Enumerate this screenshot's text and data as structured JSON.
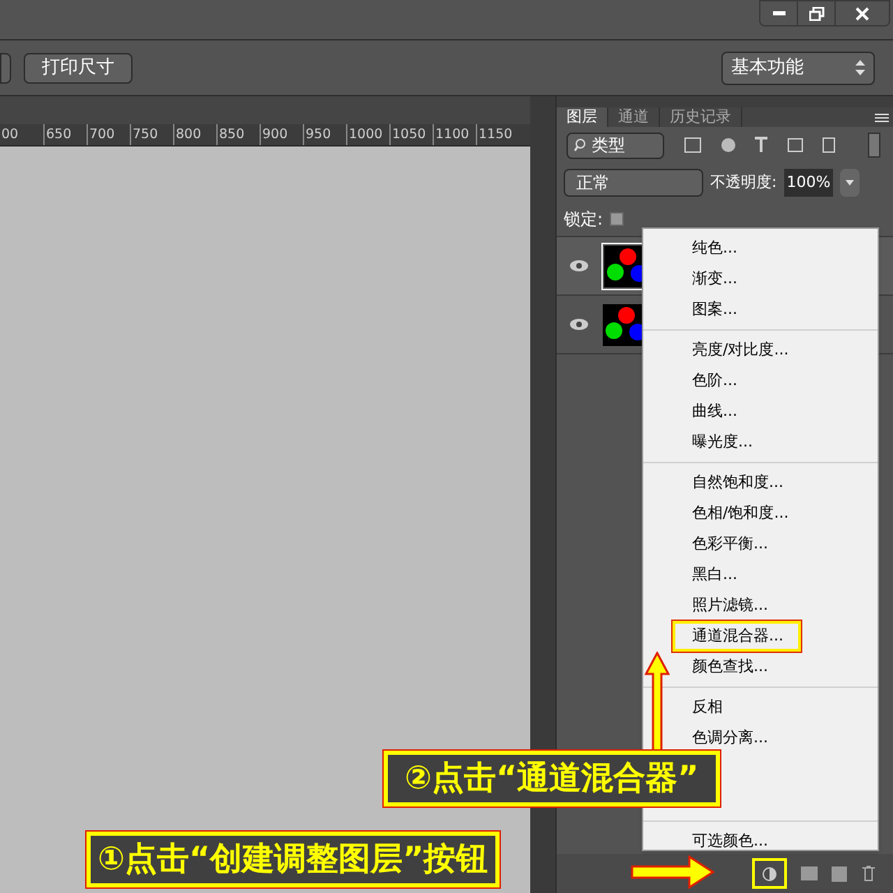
{
  "options_bar": {
    "print_size_button": "打印尺寸",
    "workspace_select": "基本功能"
  },
  "ruler": {
    "ticks": [
      "00",
      "650",
      "700",
      "750",
      "800",
      "850",
      "900",
      "950",
      "1000",
      "1050",
      "1100",
      "1150"
    ]
  },
  "panel": {
    "tabs": [
      {
        "label": "图层",
        "selected": true
      },
      {
        "label": "通道",
        "selected": false
      },
      {
        "label": "历史记录",
        "selected": false
      }
    ],
    "filter": {
      "value": "类型"
    },
    "blend_mode": "正常",
    "opacity": {
      "label": "不透明度:",
      "value": "100%"
    },
    "lock": {
      "label": "锁定:"
    },
    "layers": [
      {
        "visible": true,
        "selected": true
      },
      {
        "visible": true,
        "selected": false
      }
    ]
  },
  "menu": {
    "sections": [
      [
        {
          "label": "纯色...",
          "selected": false
        },
        {
          "label": "渐变...",
          "selected": false
        },
        {
          "label": "图案...",
          "selected": false
        }
      ],
      [
        {
          "label": "亮度/对比度...",
          "selected": false
        },
        {
          "label": "色阶...",
          "selected": false
        },
        {
          "label": "曲线...",
          "selected": false
        },
        {
          "label": "曝光度...",
          "selected": false
        }
      ],
      [
        {
          "label": "自然饱和度...",
          "selected": false
        },
        {
          "label": "色相/饱和度...",
          "selected": false
        },
        {
          "label": "色彩平衡...",
          "selected": false
        },
        {
          "label": "黑白...",
          "selected": false
        },
        {
          "label": "照片滤镜...",
          "selected": false
        },
        {
          "label": "通道混合器...",
          "selected": true
        },
        {
          "label": "颜色查找...",
          "selected": false
        }
      ],
      [
        {
          "label": "反相",
          "selected": false
        },
        {
          "label": "色调分离...",
          "selected": false
        }
      ],
      [
        {
          "label": "可选颜色...",
          "selected": false
        }
      ]
    ]
  },
  "annotations": [
    {
      "text": "②点击“通道混合器”"
    },
    {
      "text": "①点击“创建调整图层”按钮"
    }
  ]
}
